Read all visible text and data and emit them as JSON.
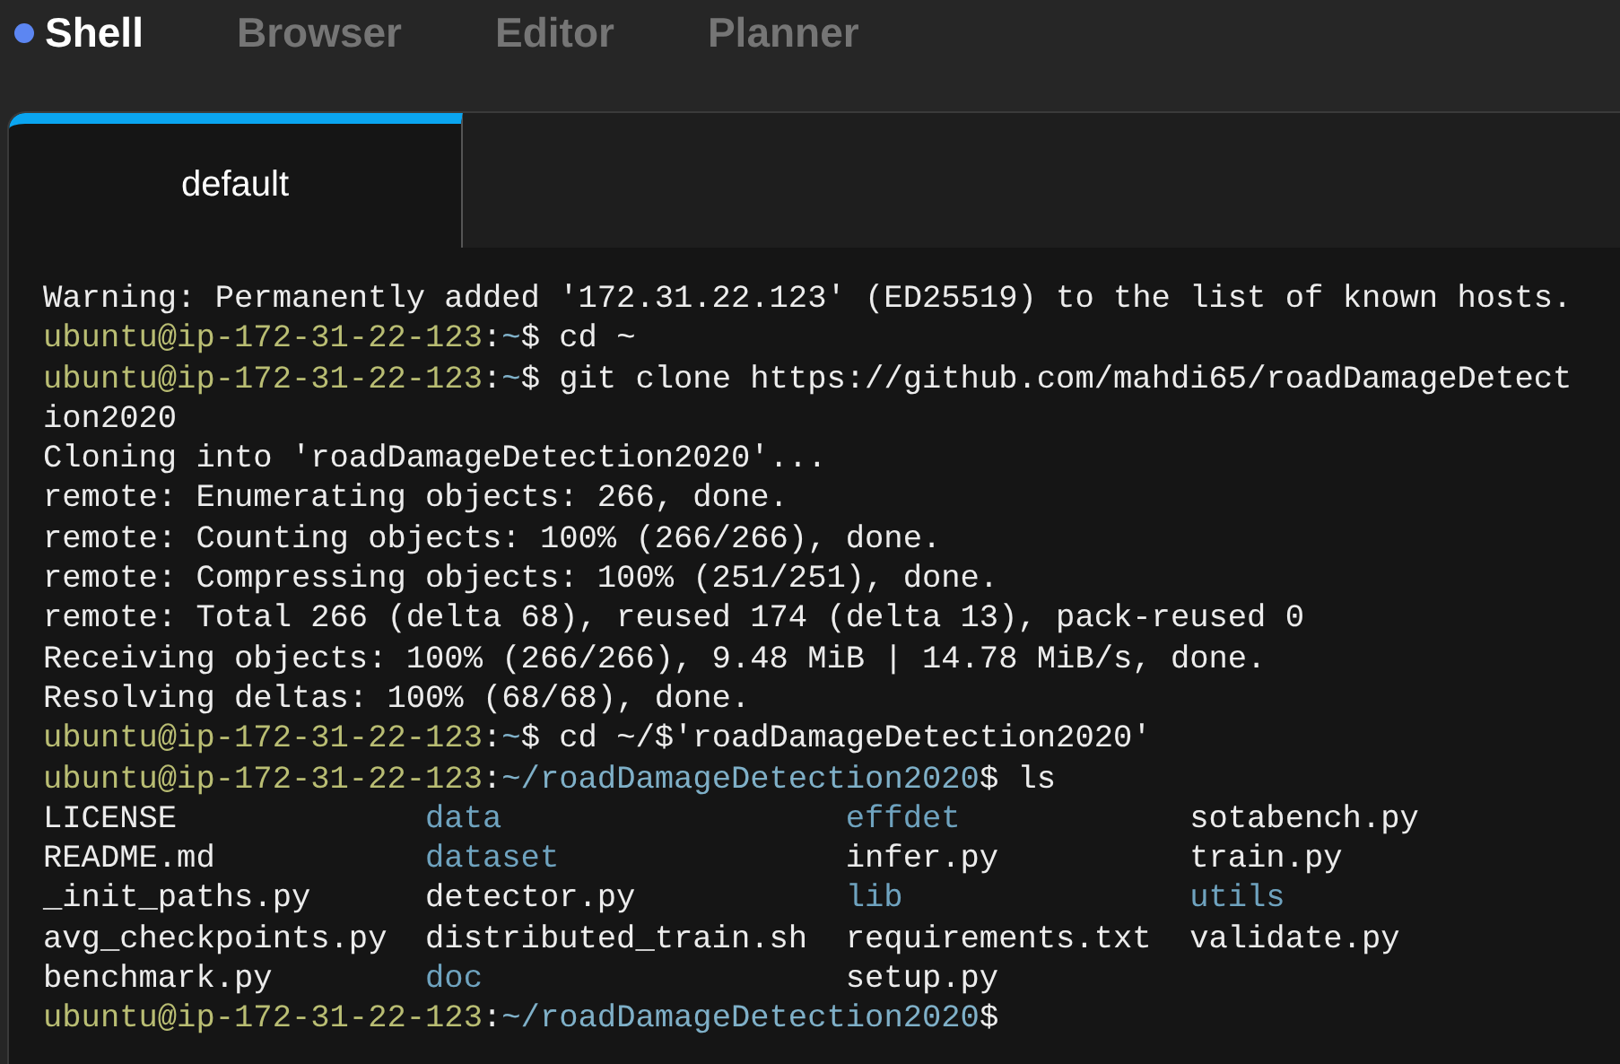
{
  "app_tabs": [
    {
      "label": "Shell",
      "selected": true
    },
    {
      "label": "Browser",
      "selected": false
    },
    {
      "label": "Editor",
      "selected": false
    },
    {
      "label": "Planner",
      "selected": false
    }
  ],
  "session_tabs": [
    {
      "label": "default",
      "selected": true
    }
  ],
  "terminal": {
    "lines": [
      {
        "segments": [
          {
            "kind": "plain",
            "text": "Warning: Permanently added '172.31.22.123' (ED25519) to the list of known hosts."
          }
        ]
      },
      {
        "segments": [
          {
            "kind": "host",
            "text": "ubuntu@ip-172-31-22-123"
          },
          {
            "kind": "plain",
            "text": ":"
          },
          {
            "kind": "path",
            "text": "~"
          },
          {
            "kind": "plain",
            "text": "$ cd ~"
          }
        ]
      },
      {
        "segments": [
          {
            "kind": "host",
            "text": "ubuntu@ip-172-31-22-123"
          },
          {
            "kind": "plain",
            "text": ":"
          },
          {
            "kind": "path",
            "text": "~"
          },
          {
            "kind": "plain",
            "text": "$ git clone https://github.com/mahdi65/roadDamageDetect"
          }
        ]
      },
      {
        "segments": [
          {
            "kind": "plain",
            "text": "ion2020"
          }
        ]
      },
      {
        "segments": [
          {
            "kind": "plain",
            "text": "Cloning into 'roadDamageDetection2020'..."
          }
        ]
      },
      {
        "segments": [
          {
            "kind": "plain",
            "text": "remote: Enumerating objects: 266, done."
          }
        ]
      },
      {
        "segments": [
          {
            "kind": "plain",
            "text": "remote: Counting objects: 100% (266/266), done."
          }
        ]
      },
      {
        "segments": [
          {
            "kind": "plain",
            "text": "remote: Compressing objects: 100% (251/251), done."
          }
        ]
      },
      {
        "segments": [
          {
            "kind": "plain",
            "text": "remote: Total 266 (delta 68), reused 174 (delta 13), pack-reused 0"
          }
        ]
      },
      {
        "segments": [
          {
            "kind": "plain",
            "text": "Receiving objects: 100% (266/266), 9.48 MiB | 14.78 MiB/s, done."
          }
        ]
      },
      {
        "segments": [
          {
            "kind": "plain",
            "text": "Resolving deltas: 100% (68/68), done."
          }
        ]
      },
      {
        "segments": [
          {
            "kind": "host",
            "text": "ubuntu@ip-172-31-22-123"
          },
          {
            "kind": "plain",
            "text": ":"
          },
          {
            "kind": "path",
            "text": "~"
          },
          {
            "kind": "plain",
            "text": "$ cd ~/$'roadDamageDetection2020'"
          }
        ]
      },
      {
        "segments": [
          {
            "kind": "host",
            "text": "ubuntu@ip-172-31-22-123"
          },
          {
            "kind": "plain",
            "text": ":"
          },
          {
            "kind": "path",
            "text": "~/roadDamageDetection2020"
          },
          {
            "kind": "plain",
            "text": "$ ls"
          }
        ]
      }
    ],
    "listing": [
      [
        {
          "kind": "file",
          "text": "LICENSE"
        },
        {
          "kind": "dir",
          "text": "data"
        },
        {
          "kind": "dir",
          "text": "effdet"
        },
        {
          "kind": "file",
          "text": "sotabench.py"
        }
      ],
      [
        {
          "kind": "file",
          "text": "README.md"
        },
        {
          "kind": "dir",
          "text": "dataset"
        },
        {
          "kind": "file",
          "text": "infer.py"
        },
        {
          "kind": "file",
          "text": "train.py"
        }
      ],
      [
        {
          "kind": "file",
          "text": "_init_paths.py"
        },
        {
          "kind": "file",
          "text": "detector.py"
        },
        {
          "kind": "dir",
          "text": "lib"
        },
        {
          "kind": "dir",
          "text": "utils"
        }
      ],
      [
        {
          "kind": "file",
          "text": "avg_checkpoints.py"
        },
        {
          "kind": "file",
          "text": "distributed_train.sh"
        },
        {
          "kind": "file",
          "text": "requirements.txt"
        },
        {
          "kind": "file",
          "text": "validate.py"
        }
      ],
      [
        {
          "kind": "file",
          "text": "benchmark.py"
        },
        {
          "kind": "dir",
          "text": "doc"
        },
        {
          "kind": "file",
          "text": "setup.py"
        }
      ]
    ],
    "final_prompt": {
      "segments": [
        {
          "kind": "host",
          "text": "ubuntu@ip-172-31-22-123"
        },
        {
          "kind": "plain",
          "text": ":"
        },
        {
          "kind": "path",
          "text": "~/roadDamageDetection2020"
        },
        {
          "kind": "plain",
          "text": "$"
        }
      ]
    }
  }
}
